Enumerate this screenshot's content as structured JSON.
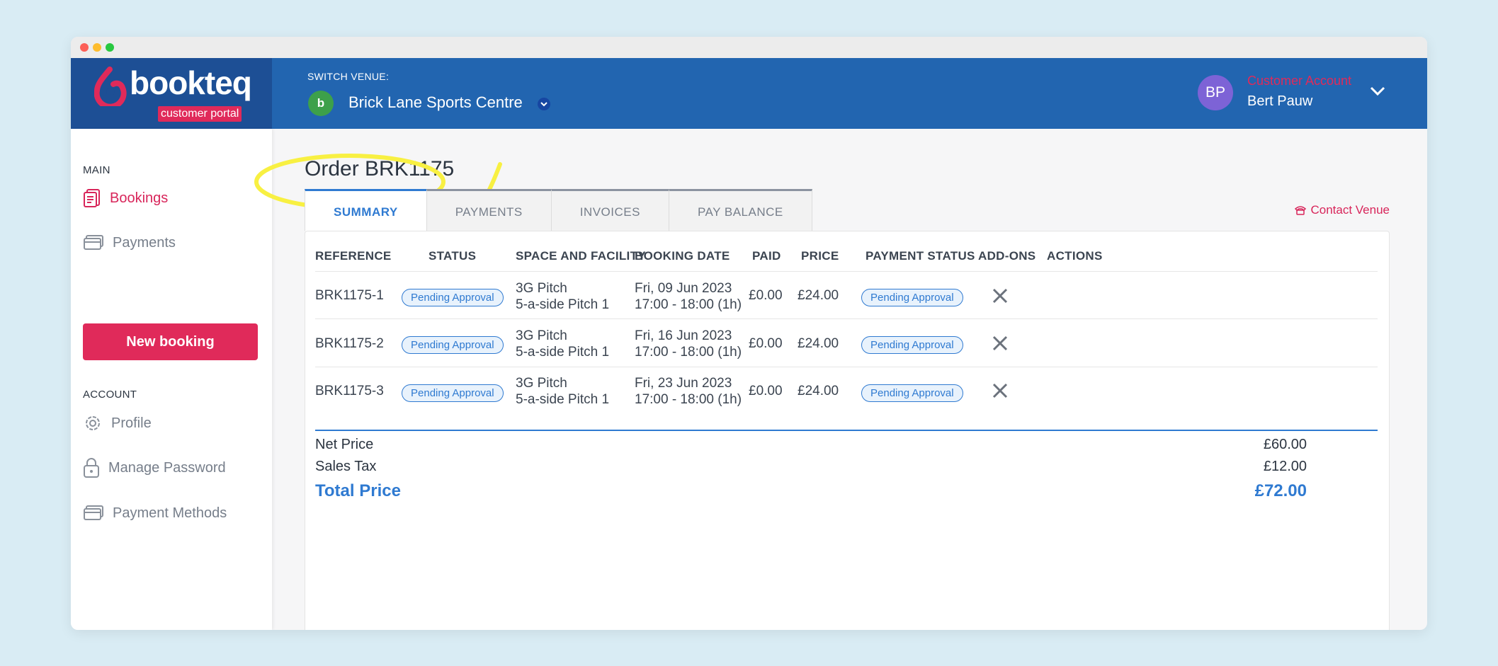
{
  "brand": {
    "name": "bookteq",
    "badge": "customer portal",
    "accent": "#e02a5a",
    "header_color": "#2265b0"
  },
  "header": {
    "switch_label": "SWITCH VENUE:",
    "venue_icon": "b",
    "venue_name": "Brick Lane Sports Centre",
    "account": {
      "initials": "BP",
      "type": "Customer Account",
      "name": "Bert Pauw"
    }
  },
  "sidebar": {
    "main_label": "MAIN",
    "items": [
      {
        "label": "Bookings",
        "icon": "bookings-icon",
        "active": true
      },
      {
        "label": "Payments",
        "icon": "card-icon",
        "active": false
      }
    ],
    "new_booking": "New booking",
    "account_label": "ACCOUNT",
    "account_items": [
      {
        "label": "Profile",
        "icon": "gear-icon"
      },
      {
        "label": "Manage Password",
        "icon": "lock-icon"
      },
      {
        "label": "Payment Methods",
        "icon": "card-icon"
      }
    ]
  },
  "page": {
    "title": "Order BRK1175",
    "tabs": [
      "SUMMARY",
      "PAYMENTS",
      "INVOICES",
      "PAY BALANCE"
    ],
    "contact": "Contact Venue"
  },
  "table": {
    "headers": [
      "REFERENCE",
      "STATUS",
      "SPACE AND FACILITY",
      "BOOKING DATE",
      "PAID",
      "PRICE",
      "PAYMENT STATUS",
      "ADD-ONS",
      "ACTIONS"
    ],
    "rows": [
      {
        "ref": "BRK1175-1",
        "status": "Pending Approval",
        "space": "3G Pitch",
        "facility": "5-a-side Pitch 1",
        "date": "Fri, 09 Jun 2023",
        "time": "17:00 - 18:00 (1h)",
        "paid": "£0.00",
        "price": "£24.00",
        "payment_status": "Pending Approval"
      },
      {
        "ref": "BRK1175-2",
        "status": "Pending Approval",
        "space": "3G Pitch",
        "facility": "5-a-side Pitch 1",
        "date": "Fri, 16 Jun 2023",
        "time": "17:00 - 18:00 (1h)",
        "paid": "£0.00",
        "price": "£24.00",
        "payment_status": "Pending Approval"
      },
      {
        "ref": "BRK1175-3",
        "status": "Pending Approval",
        "space": "3G Pitch",
        "facility": "5-a-side Pitch 1",
        "date": "Fri, 23 Jun 2023",
        "time": "17:00 - 18:00 (1h)",
        "paid": "£0.00",
        "price": "£24.00",
        "payment_status": "Pending Approval"
      }
    ]
  },
  "totals": {
    "net_label": "Net Price",
    "net_value": "£60.00",
    "tax_label": "Sales Tax",
    "tax_value": "£12.00",
    "total_label": "Total Price",
    "total_value": "£72.00"
  }
}
